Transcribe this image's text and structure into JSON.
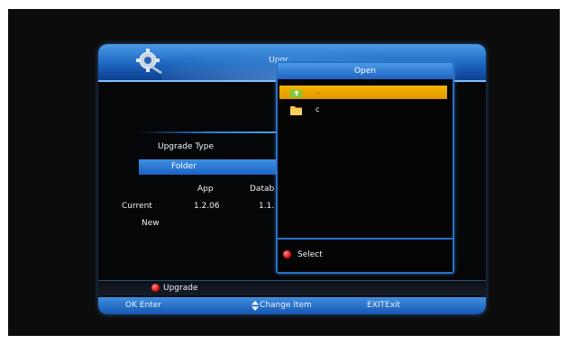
{
  "window": {
    "title": "Upgr",
    "upgrade_type_label": "Upgrade Type",
    "upgrade_type_value": "Folder",
    "columns": {
      "app": "App",
      "database": "Datab"
    },
    "rows": [
      {
        "label": "Current",
        "app": "1.2.06",
        "database": "1.1."
      },
      {
        "label": "New",
        "app": "",
        "database": ""
      }
    ],
    "upgrade_button_label": "Upgrade"
  },
  "help_bar": {
    "ok_key": "OK",
    "ok_action": "Enter",
    "change_action": "Change Item",
    "exit_key": "EXIT",
    "exit_action": "Exit"
  },
  "dialog": {
    "title": "Open",
    "items": [
      {
        "name": "..",
        "icon": "parent-folder-icon",
        "selected": true
      },
      {
        "name": "c",
        "icon": "folder-icon",
        "selected": false
      }
    ],
    "select_label": "Select"
  },
  "colors": {
    "accent_blue": "#1d66c0",
    "selection_amber": "#f6b400",
    "red_button": "#e01818"
  }
}
